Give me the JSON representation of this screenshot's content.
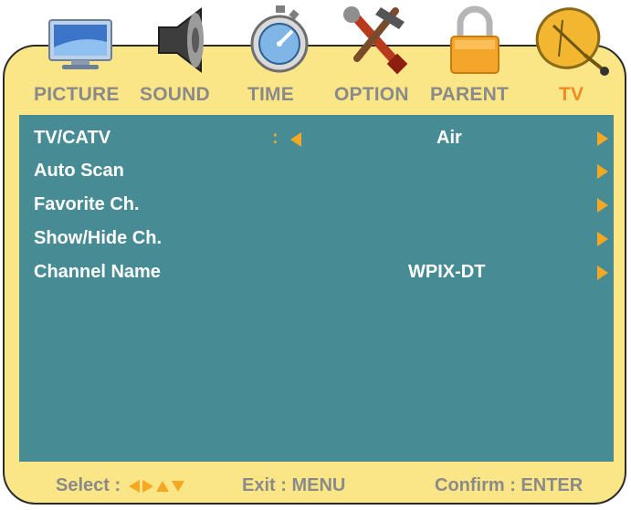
{
  "tabs": [
    {
      "label": "PICTURE",
      "icon": "monitor-icon"
    },
    {
      "label": "SOUND",
      "icon": "speaker-icon"
    },
    {
      "label": "TIME",
      "icon": "stopwatch-icon"
    },
    {
      "label": "OPTION",
      "icon": "tools-icon"
    },
    {
      "label": "PARENT",
      "icon": "padlock-icon"
    },
    {
      "label": "TV",
      "icon": "satellite-dish-icon",
      "active": true
    }
  ],
  "menu": {
    "rows": [
      {
        "label": "TV/CATV",
        "value": "Air",
        "has_left_selector": true,
        "selector_prefix": ":"
      },
      {
        "label": "Auto Scan",
        "value": ""
      },
      {
        "label": "Favorite Ch.",
        "value": ""
      },
      {
        "label": "Show/Hide Ch.",
        "value": ""
      },
      {
        "label": "Channel Name",
        "value": "WPIX-DT"
      }
    ]
  },
  "footer": {
    "select_label": "Select :",
    "exit_label": "Exit : MENU",
    "confirm_label": "Confirm : ENTER"
  },
  "colors": {
    "frame": "#fbe687",
    "panel": "#478c94",
    "accent": "#f7a823",
    "active_tab": "#f08a24",
    "inactive_text": "#8a8a8a"
  }
}
